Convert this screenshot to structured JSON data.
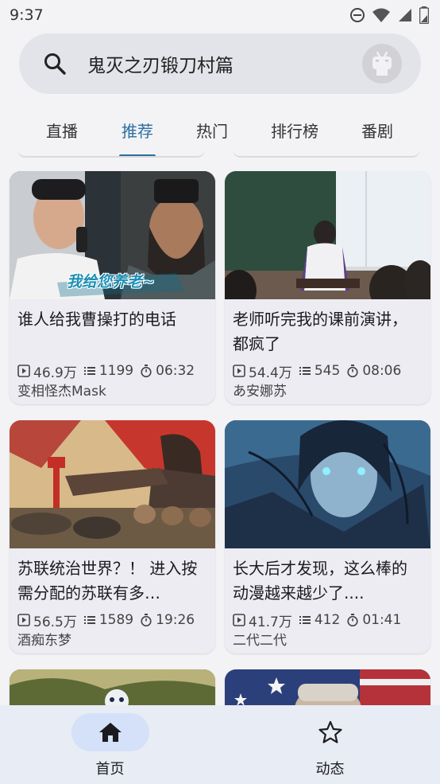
{
  "status": {
    "time": "9:37"
  },
  "search": {
    "query": "鬼灭之刃锻刀村篇"
  },
  "tabs": [
    {
      "label": "直播",
      "active": false
    },
    {
      "label": "推荐",
      "active": true
    },
    {
      "label": "热门",
      "active": false
    },
    {
      "label": "排行榜",
      "active": false
    },
    {
      "label": "番剧",
      "active": false
    }
  ],
  "cards": [
    {
      "title": "谁人给我曹操打的电话",
      "views": "46.9万",
      "danmaku": "1199",
      "duration": "06:32",
      "author": "变相怪杰Mask",
      "overlay_text": "我给您养老~"
    },
    {
      "title": "老师听完我的课前演讲，都疯了",
      "views": "54.4万",
      "danmaku": "545",
      "duration": "08:06",
      "author": "あ安娜苏"
    },
    {
      "title": "苏联统治世界？！ 进入按需分配的苏联有多…",
      "views": "56.5万",
      "danmaku": "1589",
      "duration": "19:26",
      "author": "酒痴东梦"
    },
    {
      "title": "长大后才发现，这么棒的动漫越来越少了....",
      "views": "41.7万",
      "danmaku": "412",
      "duration": "01:41",
      "author": "二代二代"
    }
  ],
  "bottom_nav": [
    {
      "label": "首页",
      "icon": "home-icon",
      "active": true
    },
    {
      "label": "动态",
      "icon": "star-outline-icon",
      "active": false
    }
  ],
  "colors": {
    "accent": "#2d6f9e",
    "nav_pill": "#d4e1f8"
  }
}
